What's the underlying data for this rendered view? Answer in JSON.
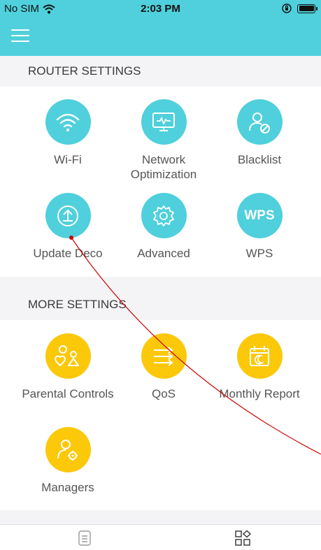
{
  "status_bar": {
    "carrier": "No SIM",
    "time": "2:03 PM"
  },
  "nav": {
    "menu_icon": "hamburger-menu-icon"
  },
  "router_settings": {
    "header": "ROUTER SETTINGS",
    "items": [
      {
        "label": "Wi-Fi",
        "icon": "wifi-icon"
      },
      {
        "label": "Network Optimization",
        "icon": "monitor-pulse-icon"
      },
      {
        "label": "Blacklist",
        "icon": "user-blocked-icon"
      },
      {
        "label": "Update Deco",
        "icon": "upload-circle-icon"
      },
      {
        "label": "Advanced",
        "icon": "gear-icon"
      },
      {
        "label": "WPS",
        "icon": "wps-icon",
        "icon_text": "WPS"
      }
    ]
  },
  "more_settings": {
    "header": "MORE SETTINGS",
    "items": [
      {
        "label": "Parental Controls",
        "icon": "family-heart-icon"
      },
      {
        "label": "QoS",
        "icon": "arrows-right-icon"
      },
      {
        "label": "Monthly Report",
        "icon": "calendar-moon-icon"
      },
      {
        "label": "Managers",
        "icon": "user-gear-icon"
      }
    ]
  },
  "tab_bar": {
    "tabs": [
      {
        "icon": "list-document-icon"
      },
      {
        "icon": "apps-grid-icon",
        "active": true
      }
    ]
  },
  "colors": {
    "teal": "#4fd0dc",
    "yellow": "#fcc80a",
    "annotation": "#cc0000"
  }
}
